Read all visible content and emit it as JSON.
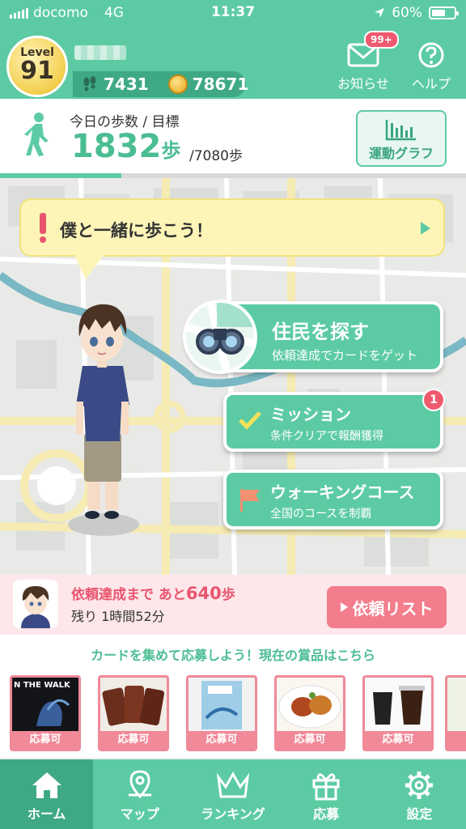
{
  "status": {
    "carrier": "docomo",
    "network": "4G",
    "time": "11:37",
    "battery": "60%",
    "battery_level": 0.6
  },
  "profile": {
    "level_label": "Level",
    "level": "91",
    "footsteps": "7431",
    "coins": "78671"
  },
  "header": {
    "notice_label": "お知らせ",
    "notice_badge": "99+",
    "help_label": "ヘルプ"
  },
  "steps": {
    "label": "今日の歩数 / 目標",
    "count": "1832",
    "unit": "歩",
    "goal": "/7080歩",
    "progress_fraction": 0.26,
    "graph_label": "運動グラフ"
  },
  "speech": {
    "text": "僕と一緒に歩こう！"
  },
  "actions": {
    "search": {
      "title": "住民を探す",
      "subtitle": "依頼達成でカードをゲット"
    },
    "mission": {
      "title": "ミッション",
      "subtitle": "条件クリアで報酬獲得",
      "badge": "1"
    },
    "course": {
      "title": "ウォーキングコース",
      "subtitle": "全国のコースを制覇"
    }
  },
  "request": {
    "prefix": "依頼達成まで あと",
    "steps": "640",
    "unit": "歩",
    "remaining": "残り 1時間52分",
    "button": "依頼リスト"
  },
  "prizes": {
    "heading": "カードを集めて応募しよう！現在の賞品はこちら",
    "cards": [
      {
        "label": "応募可",
        "caption": "N THE WALK"
      },
      {
        "label": "応募可"
      },
      {
        "label": "応募可"
      },
      {
        "label": "応募可"
      },
      {
        "label": "応募可"
      }
    ]
  },
  "tabs": [
    {
      "label": "ホーム",
      "icon": "home-icon",
      "active": true
    },
    {
      "label": "マップ",
      "icon": "map-pin-icon"
    },
    {
      "label": "ランキング",
      "icon": "crown-icon"
    },
    {
      "label": "応募",
      "icon": "gift-icon"
    },
    {
      "label": "設定",
      "icon": "gear-icon"
    }
  ],
  "colors": {
    "primary": "#5ccba3",
    "primary_dark": "#3fa985",
    "accent_pink": "#f47d8d",
    "speech_yellow": "#fdf5b8"
  }
}
